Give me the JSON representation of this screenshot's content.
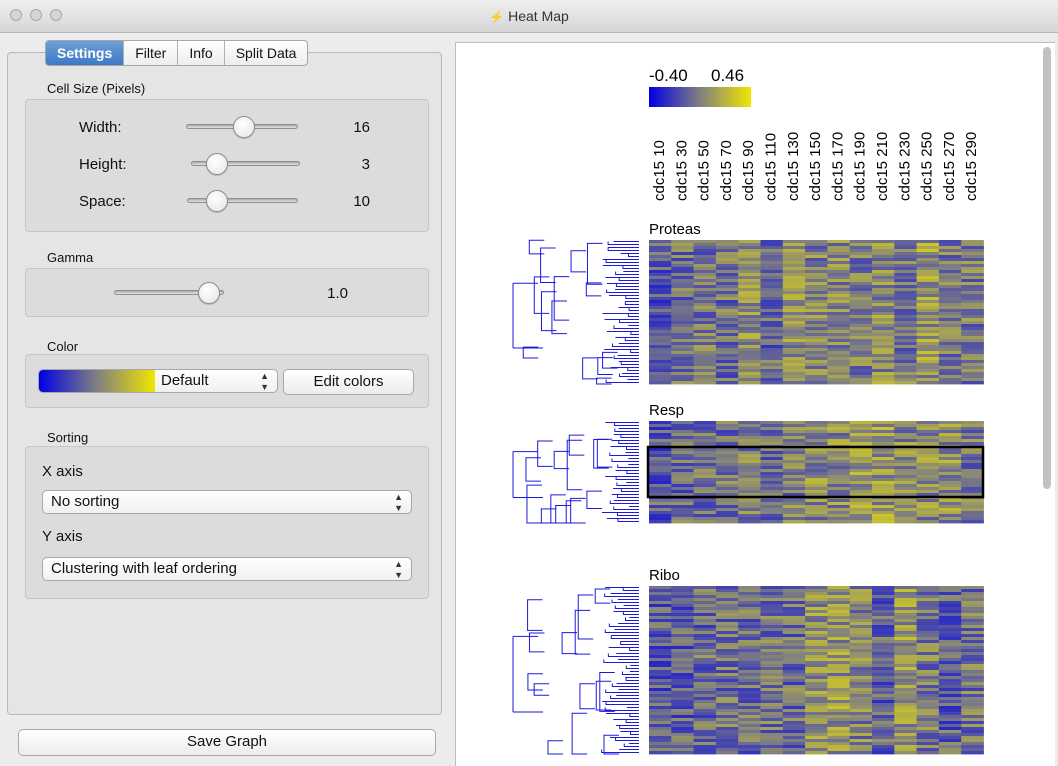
{
  "window": {
    "title": "Heat Map"
  },
  "tabs": [
    "Settings",
    "Filter",
    "Info",
    "Split Data"
  ],
  "cell_size": {
    "label": "Cell Size (Pixels)",
    "width": {
      "label": "Width:",
      "value": "16",
      "level": 0.55
    },
    "height": {
      "label": "Height:",
      "value": "3",
      "level": 0.25
    },
    "space": {
      "label": "Space:",
      "value": "10",
      "level": 0.25
    }
  },
  "gamma": {
    "label": "Gamma",
    "value": "1.0",
    "level": 0.85
  },
  "color": {
    "label": "Color",
    "scheme": "Default",
    "edit_label": "Edit colors",
    "gradient": [
      "#0000e6",
      "#808080",
      "#f0e600"
    ]
  },
  "sorting": {
    "label": "Sorting",
    "x_label": "X axis",
    "x_value": "No sorting",
    "y_label": "Y axis",
    "y_value": "Clustering with leaf ordering"
  },
  "save_label": "Save Graph",
  "heatmap": {
    "legend_min": "-0.40",
    "legend_max": "0.46",
    "columns": [
      "cdc15 10",
      "cdc15 30",
      "cdc15 50",
      "cdc15 70",
      "cdc15 90",
      "cdc15 110",
      "cdc15 130",
      "cdc15 150",
      "cdc15 170",
      "cdc15 190",
      "cdc15 210",
      "cdc15 230",
      "cdc15 250",
      "cdc15 270",
      "cdc15 290"
    ],
    "groups": [
      {
        "name": "Proteas",
        "rows": 48
      },
      {
        "name": "Resp",
        "rows": 34
      },
      {
        "name": "Ribo",
        "rows": 56
      }
    ],
    "colors": {
      "low": "#0000e6",
      "mid": "#808080",
      "high": "#f0e600",
      "dendrogram": "#1a1adf"
    }
  }
}
